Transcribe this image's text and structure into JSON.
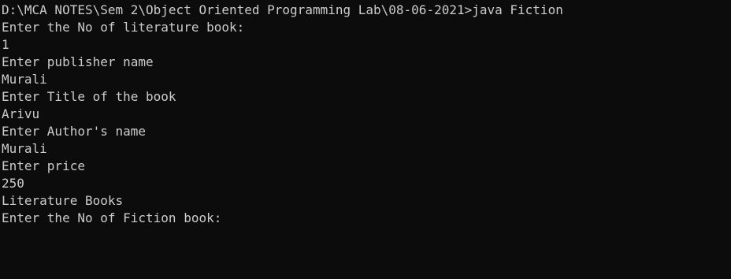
{
  "console": {
    "background": "#0c0c0c",
    "foreground": "#cccccc",
    "lines": [
      "D:\\MCA NOTES\\Sem 2\\Object Oriented Programming Lab\\08-06-2021>java Fiction",
      "Enter the No of literature book:",
      "1",
      "Enter publisher name",
      "Murali",
      "Enter Title of the book",
      "Arivu",
      "Enter Author's name",
      "Murali",
      "Enter price",
      "250",
      "Literature Books",
      "Enter the No of Fiction book:"
    ]
  }
}
